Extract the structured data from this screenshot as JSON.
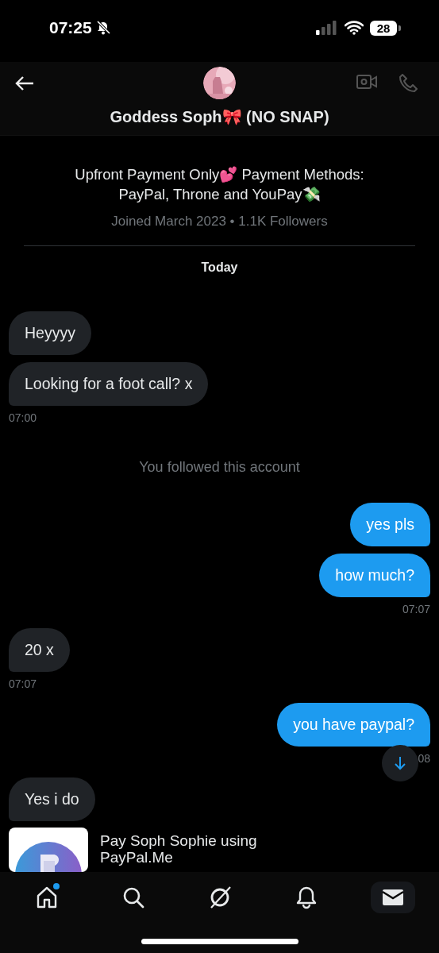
{
  "status_bar": {
    "time": "07:25",
    "battery": "28"
  },
  "header": {
    "name": "Goddess Soph🎀 (NO SNAP)"
  },
  "profile": {
    "bio": "Upfront Payment Only💕 Payment Methods: PayPal, Throne and YouPay💸",
    "meta": "Joined March 2023 • 1.1K Followers"
  },
  "date_divider": "Today",
  "messages": [
    {
      "kind": "received",
      "text": "Heyyyy"
    },
    {
      "kind": "received",
      "text": "Looking for a foot call? x"
    },
    {
      "kind": "received_time",
      "text": "07:00"
    },
    {
      "kind": "notice",
      "text": "You followed this account"
    },
    {
      "kind": "sent",
      "text": "yes pls"
    },
    {
      "kind": "sent",
      "text": "how much?"
    },
    {
      "kind": "sent_time",
      "text": "07:07"
    },
    {
      "kind": "received",
      "text": "20 x"
    },
    {
      "kind": "received_time",
      "text": "07:07"
    },
    {
      "kind": "sent",
      "text": "you have paypal?"
    },
    {
      "kind": "sent_time",
      "text": "08"
    },
    {
      "kind": "received",
      "text": "Yes i do"
    },
    {
      "kind": "link_card",
      "text": "Pay Soph Sophie using PayPal.Me"
    }
  ],
  "nav": [
    {
      "selected": false,
      "badge": true
    },
    {
      "selected": false,
      "badge": false
    },
    {
      "selected": false,
      "badge": false
    },
    {
      "selected": false,
      "badge": false
    },
    {
      "selected": true,
      "badge": false
    }
  ]
}
